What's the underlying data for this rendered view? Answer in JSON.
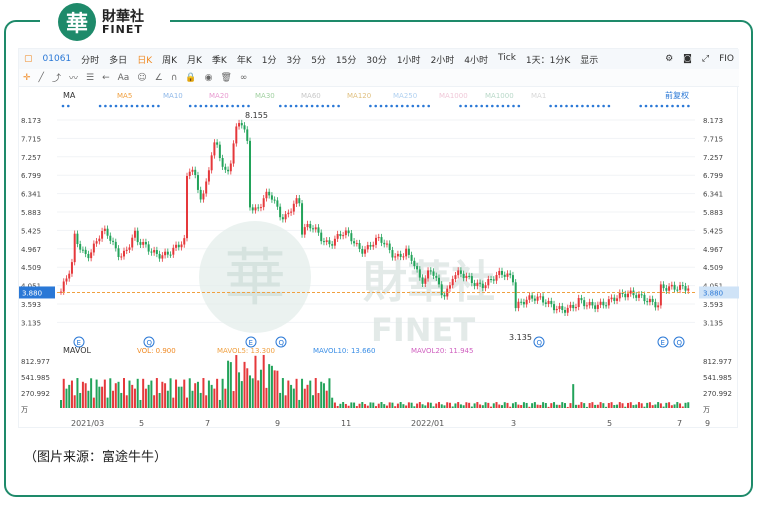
{
  "brand": {
    "badge": "華",
    "cn": "財華社",
    "en": "FINET"
  },
  "toolbar": {
    "code": "01061",
    "periods": [
      "分时",
      "多日",
      "日K",
      "周K",
      "月K",
      "季K",
      "年K",
      "1分",
      "3分",
      "5分",
      "15分",
      "30分",
      "1小时",
      "2小时",
      "4小时",
      "Tick",
      "1天：1分K",
      "显示"
    ],
    "active_period": "日K",
    "right": "FIO"
  },
  "indicator": {
    "name": "MA",
    "items": [
      "MA5",
      "MA10",
      "MA20",
      "MA30",
      "MA60",
      "MA120",
      "MA250",
      "MA1000",
      "MA1000",
      "MA1"
    ],
    "adjust": "前复权"
  },
  "price_axis": [
    "8.173",
    "7.715",
    "7.257",
    "6.799",
    "6.341",
    "5.883",
    "5.425",
    "4.967",
    "4.509",
    "4.051",
    "3.593",
    "3.135"
  ],
  "current_price": "3.880",
  "high_label": "8.155",
  "low_label": "3.135",
  "watermark": {
    "badge": "華",
    "cn": "財華社",
    "en": "FINET"
  },
  "volume": {
    "title": "MAVOL",
    "items": [
      {
        "label": "VOL: 0.900",
        "color": "#f08a24"
      },
      {
        "label": "MAVOL5: 13.300",
        "color": "#f0a040"
      },
      {
        "label": "MAVOL10: 13.660",
        "color": "#3a8ee6"
      },
      {
        "label": "MAVOL20: 11.945",
        "color": "#d060c0"
      }
    ],
    "axis": [
      "812.977",
      "541.985",
      "270.992",
      "万"
    ]
  },
  "x_axis": [
    "2021/03",
    "5",
    "7",
    "9",
    "11",
    "2022/01",
    "3",
    "5",
    "7",
    "9"
  ],
  "caption": "（图片来源：富途牛牛）"
}
